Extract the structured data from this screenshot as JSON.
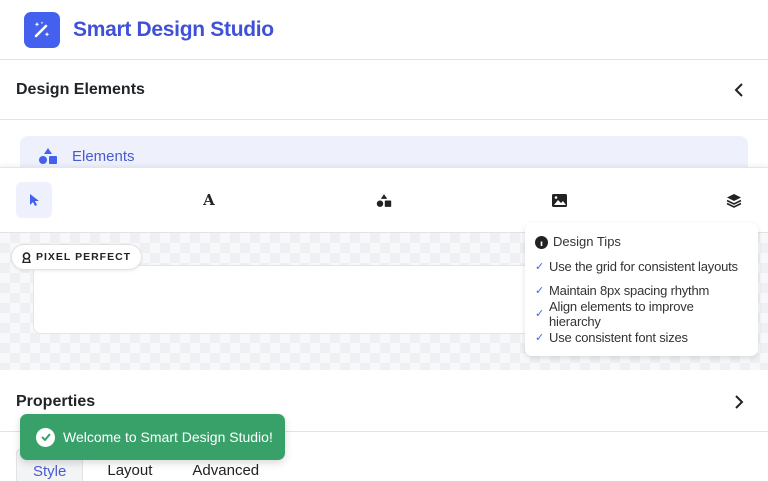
{
  "app": {
    "title": "Smart Design Studio"
  },
  "design_elements": {
    "title": "Design Elements",
    "selected_item": "Elements"
  },
  "toolbar": {
    "tools": [
      "select",
      "text",
      "shapes",
      "image",
      "layers"
    ]
  },
  "canvas": {
    "badge": "PIXEL PERFECT",
    "tips": {
      "title": "Design Tips",
      "items": [
        "Use the grid for consistent layouts",
        "Maintain 8px spacing rhythm",
        "Align elements to improve hierarchy",
        "Use consistent font sizes"
      ]
    }
  },
  "properties": {
    "title": "Properties",
    "tabs": [
      "Style",
      "Layout",
      "Advanced"
    ]
  },
  "toast": {
    "message": "Welcome to Smart Design Studio!"
  },
  "colors": {
    "accent": "#4361ee",
    "success": "#38a169"
  }
}
